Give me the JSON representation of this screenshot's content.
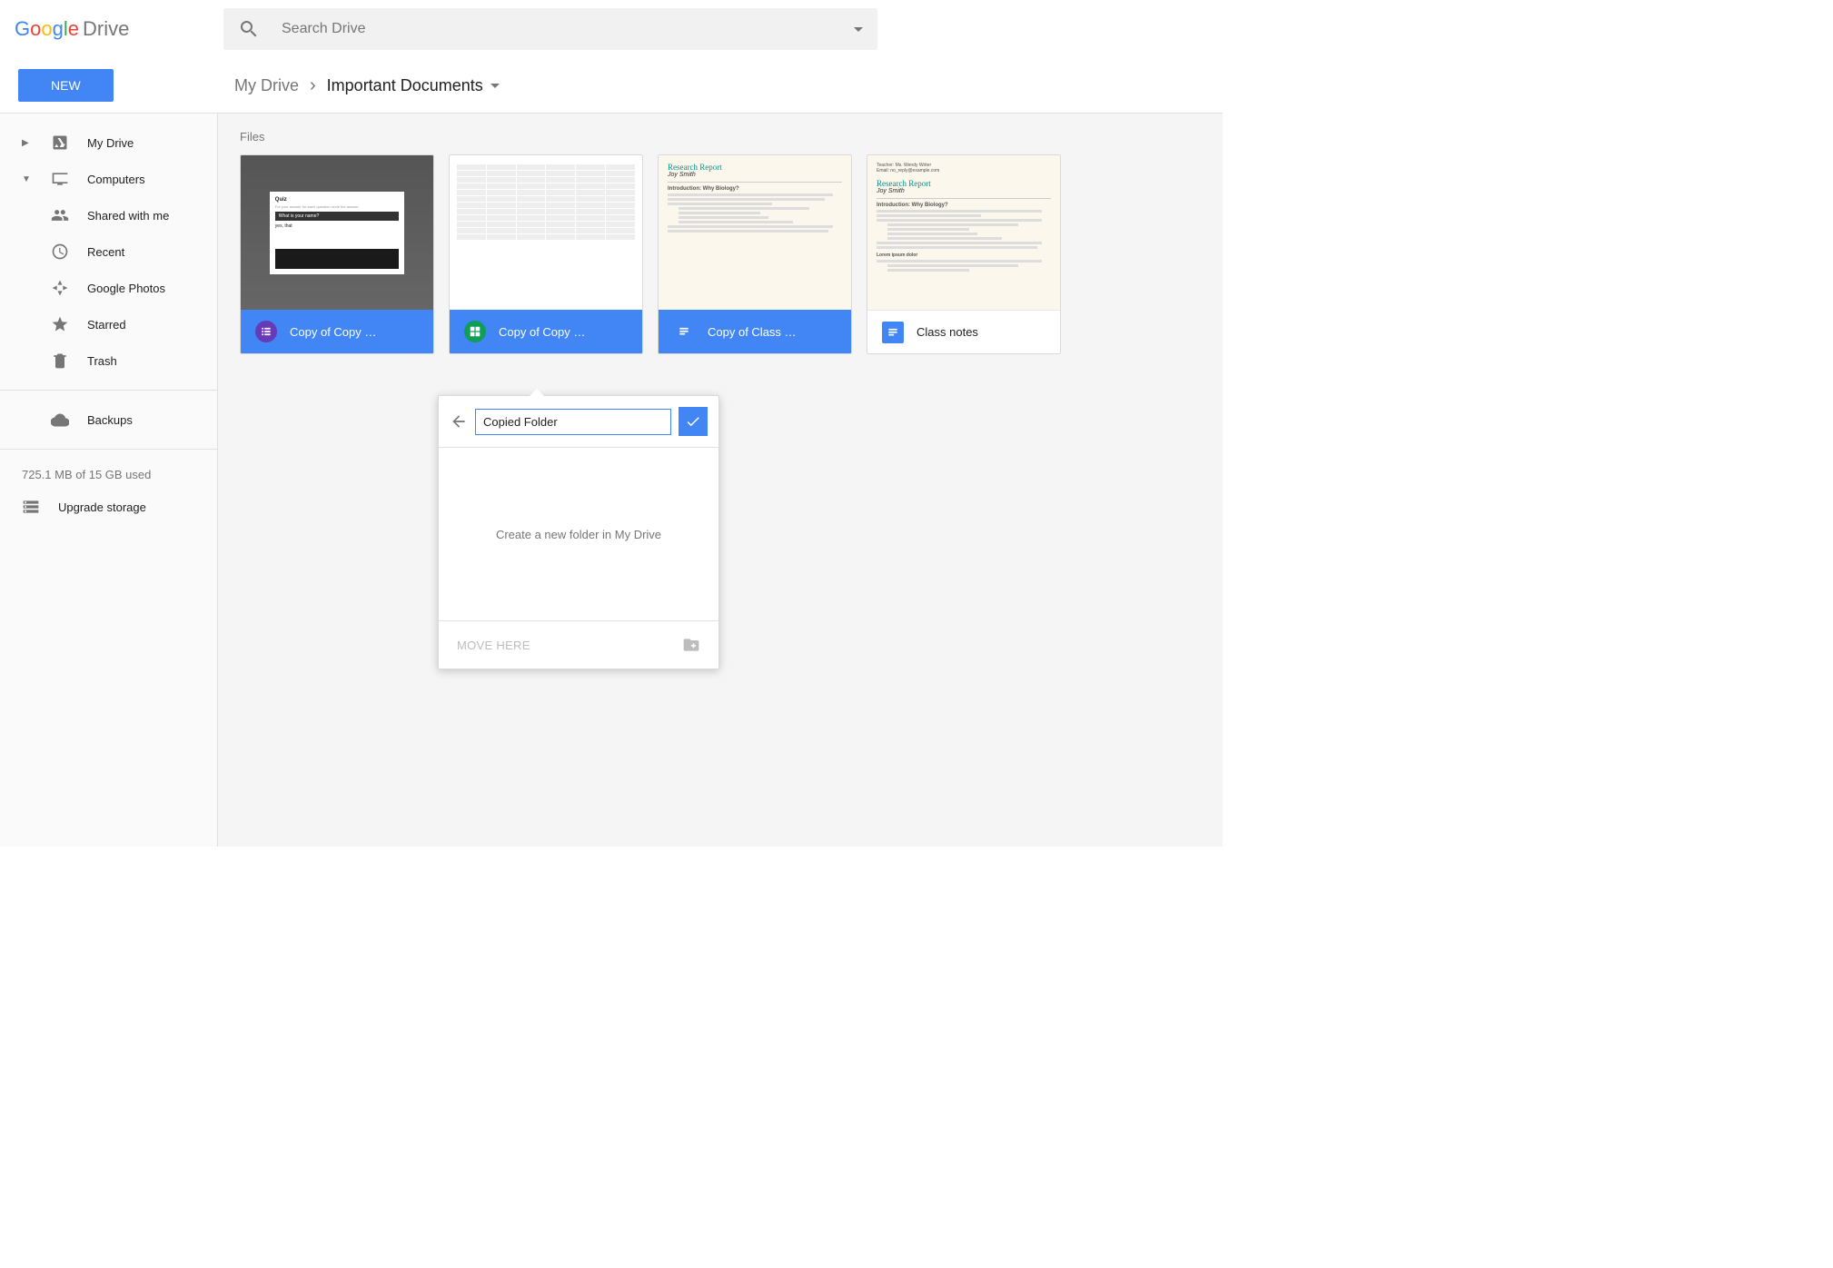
{
  "header": {
    "logo_drive": "Drive",
    "search_placeholder": "Search Drive"
  },
  "subheader": {
    "new_button": "NEW",
    "breadcrumb_root": "My Drive",
    "breadcrumb_current": "Important Documents"
  },
  "sidebar": {
    "items": [
      {
        "label": "My Drive",
        "expandable": true,
        "expanded": false
      },
      {
        "label": "Computers",
        "expandable": true,
        "expanded": true
      },
      {
        "label": "Shared with me"
      },
      {
        "label": "Recent"
      },
      {
        "label": "Google Photos"
      },
      {
        "label": "Starred"
      },
      {
        "label": "Trash"
      }
    ],
    "backups_label": "Backups",
    "storage_text": "725.1 MB of 15 GB used",
    "upgrade_label": "Upgrade storage"
  },
  "main": {
    "section_label": "Files",
    "files": [
      {
        "name": "Copy of Copy …",
        "type": "forms",
        "selected": true
      },
      {
        "name": "Copy of Copy …",
        "type": "sheets",
        "selected": true
      },
      {
        "name": "Copy of Class …",
        "type": "docs",
        "selected": true
      },
      {
        "name": "Class notes",
        "type": "docs-sq",
        "selected": false
      }
    ],
    "thumb": {
      "quiz_title": "Quiz",
      "quiz_question": "What is your name?",
      "quiz_answer": "yes, that",
      "doc_title": "Research Report",
      "doc_author": "Joy Smith",
      "doc_heading": "Introduction: Why Biology?"
    }
  },
  "move_dialog": {
    "folder_name": "Copied Folder",
    "empty_text": "Create a new folder in My Drive",
    "move_here": "MOVE HERE"
  }
}
